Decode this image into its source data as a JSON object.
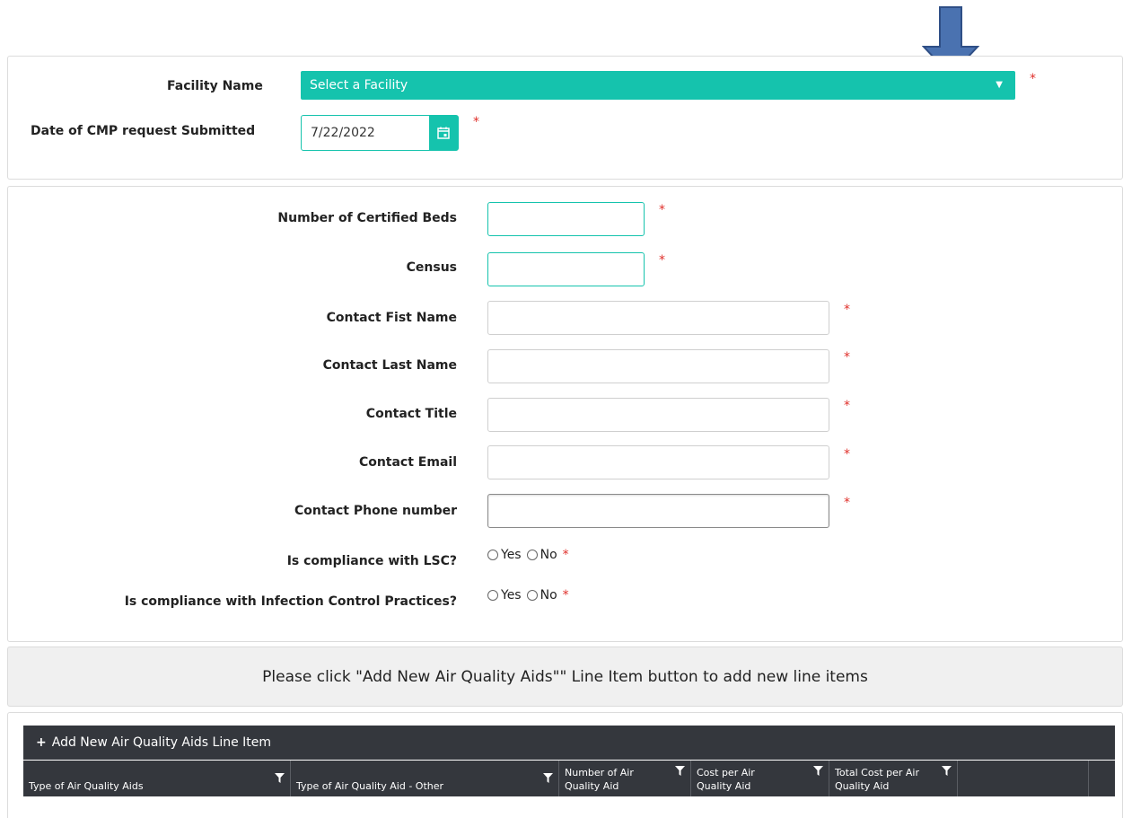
{
  "colors": {
    "accent": "#15c3ad",
    "required": "#e0302b",
    "grid_header": "#34373d",
    "arrow": "#4a72b0"
  },
  "facility": {
    "label": "Facility Name",
    "placeholder": "Select a Facility",
    "caret": "▼",
    "required": "*"
  },
  "date": {
    "label": "Date of CMP request Submitted",
    "value": "7/22/2022",
    "icon": "calendar-icon",
    "required": "*"
  },
  "fields": {
    "certified_beds": {
      "label": "Number of Certified Beds",
      "value": "",
      "required": "*"
    },
    "census": {
      "label": "Census",
      "value": "",
      "required": "*"
    },
    "first_name": {
      "label": "Contact Fist Name",
      "value": "",
      "required": "*"
    },
    "last_name": {
      "label": "Contact Last Name",
      "value": "",
      "required": "*"
    },
    "title": {
      "label": "Contact Title",
      "value": "",
      "required": "*"
    },
    "email": {
      "label": "Contact Email",
      "value": "",
      "required": "*"
    },
    "phone": {
      "label": "Contact Phone number",
      "value": "",
      "required": "*"
    }
  },
  "questions": {
    "lsc": {
      "label": "Is compliance with LSC?",
      "yes": "Yes",
      "no": "No",
      "required": "*"
    },
    "infection": {
      "label": "Is compliance with Infection Control Practices?",
      "yes": "Yes",
      "no": "No",
      "required": "*"
    }
  },
  "notice": "Please click \"Add New Air Quality Aids\"\" Line Item button to add new line items",
  "grid": {
    "add_button_icon": "+",
    "add_button": "Add New Air Quality Aids Line Item",
    "columns": [
      {
        "label": "Type of Air Quality Aids",
        "icon": "filter-icon"
      },
      {
        "label": "Type of Air Quality Aid - Other",
        "icon": "filter-icon"
      },
      {
        "label": "Number of Air Quality Aid",
        "icon": "filter-icon"
      },
      {
        "label": "Cost per Air Quality Aid",
        "icon": "filter-icon"
      },
      {
        "label": "Total Cost per Air Quality Aid",
        "icon": "filter-icon"
      }
    ]
  }
}
